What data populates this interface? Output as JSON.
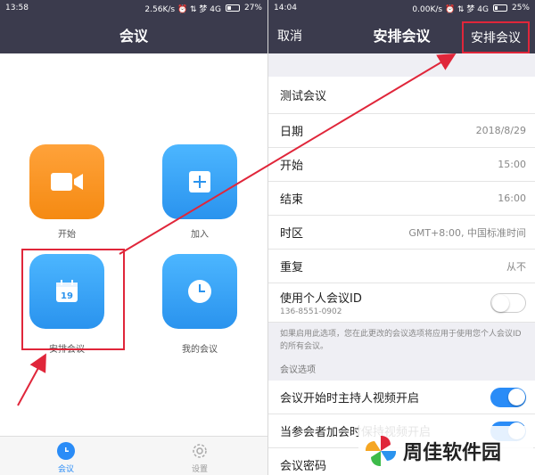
{
  "left_screen": {
    "status": {
      "time": "13:58",
      "indicators": "2.56K/s ⏰ ⇅ 梦 4G",
      "battery": "27%"
    },
    "title": "会议",
    "tiles": [
      {
        "label": "开始",
        "icon": "video-camera-icon",
        "color": "#f79a22"
      },
      {
        "label": "加入",
        "icon": "plus-icon",
        "color": "#2a93ee"
      },
      {
        "label": "安排会议",
        "icon": "calendar-icon",
        "calendar_day": "19",
        "color": "#2a93ee"
      },
      {
        "label": "我的会议",
        "icon": "clock-icon",
        "color": "#2a93ee"
      }
    ],
    "tabs": [
      {
        "label": "会议",
        "icon": "clock-icon",
        "active": true
      },
      {
        "label": "设置",
        "icon": "gear-icon",
        "active": false
      }
    ]
  },
  "right_screen": {
    "status": {
      "time": "14:04",
      "indicators": "0.00K/s ⏰ ⇅ 梦 4G",
      "battery": "25%"
    },
    "cancel_label": "取消",
    "title": "安排会议",
    "schedule_label": "安排会议",
    "topic": "测试会议",
    "rows": {
      "date": {
        "label": "日期",
        "value": "2018/8/29"
      },
      "start": {
        "label": "开始",
        "value": "15:00"
      },
      "end": {
        "label": "结束",
        "value": "16:00"
      },
      "timezone": {
        "label": "时区",
        "value": "GMT+8:00, 中国标准时间"
      },
      "repeat": {
        "label": "重复",
        "value": "从不"
      }
    },
    "pmi": {
      "label": "使用个人会议ID",
      "id": "136-8551-0902",
      "enabled": false
    },
    "pmi_note": "如果启用此选项，您在此更改的会议选项将应用于使用您个人会议ID的所有会议。",
    "options_header": "会议选项",
    "host_video": {
      "label": "会议开始时主持人视频开启",
      "enabled": true
    },
    "participant_video": {
      "label": "当参会者加会时保持视频开启",
      "enabled": true
    },
    "password": {
      "label": "会议密码"
    }
  },
  "watermark": {
    "text": "周佳软件园"
  },
  "colors": {
    "accent": "#2a8cf7",
    "highlight": "#e0263a",
    "navbar": "#3b3b4d"
  }
}
